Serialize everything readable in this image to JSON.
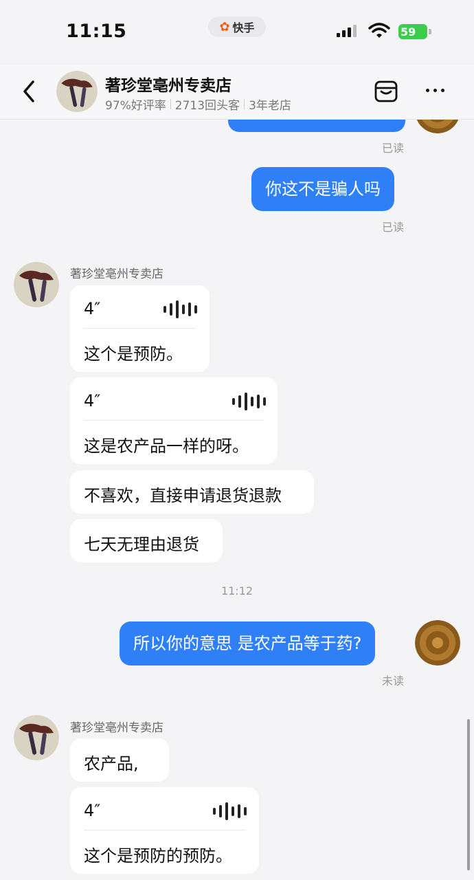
{
  "status_bar": {
    "time": "11:15",
    "app_badge": "快手",
    "battery": "59"
  },
  "header": {
    "shop_name": "著珍堂亳州专卖店",
    "rating": "97%好评率",
    "repeat_customers": "2713回头客",
    "store_age": "3年老店"
  },
  "messages": {
    "read_1": "已读",
    "m1": "你这不是骗人吗",
    "read_2": "已读",
    "sender_1": "著珍堂亳州专卖店",
    "voice_1_len": "4″",
    "voice_1_text": "这个是预防。",
    "voice_2_len": "4″",
    "voice_2_text": "这是农产品一样的呀。",
    "t1": "不喜欢，直接申请退货退款",
    "t2": "七天无理由退货",
    "timestamp": "11:12",
    "m2": "所以你的意思 是农产品等于药?",
    "unread": "未读",
    "sender_2": "著珍堂亳州专卖店",
    "t3": "农产品,",
    "voice_3_len": "4″",
    "voice_3_text": "这个是预防的预防。"
  },
  "colors": {
    "accent_blue": "#2f80f6",
    "background": "#f4f4f6",
    "battery_green": "#3ccd4d"
  }
}
